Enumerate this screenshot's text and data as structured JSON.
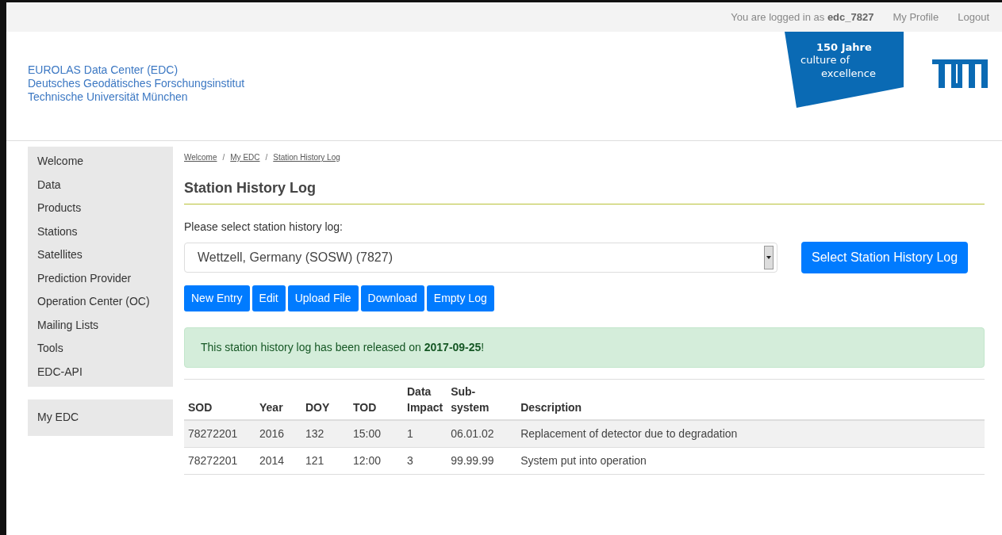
{
  "top_bar": {
    "login_text": "You are logged in as **edc_7827**",
    "links": [
      "My Profile",
      "Logout"
    ]
  },
  "header": {
    "lines": [
      "EUROLAS Data Center (EDC)",
      "Deutsches Geodätisches Forschungsinstitut",
      "Technische Universität München"
    ],
    "badge": [
      "150 Jahre",
      "culture of",
      "excellence"
    ]
  },
  "sidebar": {
    "items": [
      {
        "label": "Welcome"
      },
      {
        "label": "Data"
      },
      {
        "label": "Products"
      },
      {
        "label": "Stations"
      },
      {
        "label": "Satellites"
      },
      {
        "label": "Prediction Provider"
      },
      {
        "label": "Operation Center (OC)"
      },
      {
        "label": "Mailing Lists"
      },
      {
        "label": "Tools"
      },
      {
        "label": "EDC-API"
      }
    ],
    "secondary": [
      {
        "label": "My EDC"
      }
    ]
  },
  "breadcrumb": {
    "separator": "/",
    "items": [
      "Welcome",
      "My EDC",
      "Station History Log"
    ]
  },
  "title": "Station History Log",
  "select": {
    "label": "Please select station history log:",
    "value": "Wettzell, Germany (SOSW) (7827)",
    "button": "Select Station History Log"
  },
  "actions": [
    "New Entry",
    "Edit",
    "Upload File",
    "Download",
    "Empty Log"
  ],
  "alert": "This station history log has been released on **2017-09-25**!",
  "table": {
    "columns": [
      "SOD",
      "Year",
      "DOY",
      "TOD",
      "Data Impact",
      "Sub- system",
      "Description"
    ],
    "rows": [
      [
        "78272201",
        "2016",
        "132",
        "15:00",
        "1",
        "06.01.02",
        "Replacement of detector due to degradation"
      ],
      [
        "78272201",
        "2014",
        "121",
        "12:00",
        "3",
        "99.99.99",
        "System put into operation"
      ]
    ]
  }
}
